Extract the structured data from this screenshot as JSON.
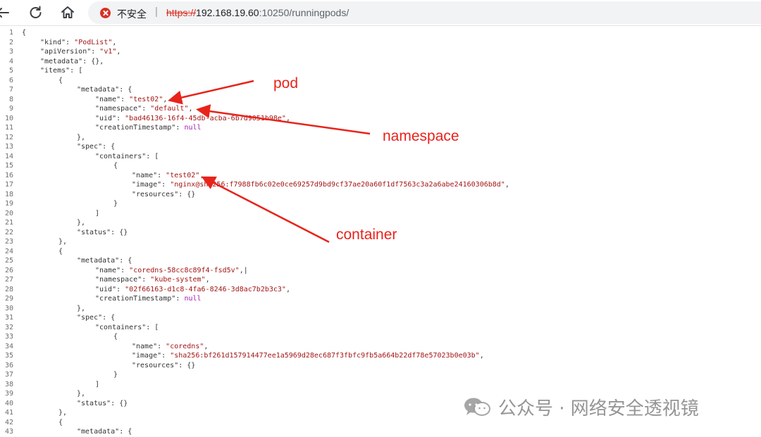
{
  "browser": {
    "security_label": "不安全",
    "url_scheme": "https://",
    "url_host": "192.168.19.60",
    "url_path": ":10250/runningpods/",
    "colors": {
      "warning": "#d93025",
      "scheme_strike": "#d93025"
    }
  },
  "json_view": {
    "lines": [
      {
        "n": "1",
        "indent": 0,
        "t": [
          [
            "p",
            "{"
          ]
        ]
      },
      {
        "n": "2",
        "indent": 1,
        "t": [
          [
            "k",
            "\"kind\""
          ],
          [
            "p",
            ": "
          ],
          [
            "s",
            "\"PodList\""
          ],
          [
            "p",
            ","
          ]
        ]
      },
      {
        "n": "3",
        "indent": 1,
        "t": [
          [
            "k",
            "\"apiVersion\""
          ],
          [
            "p",
            ": "
          ],
          [
            "s",
            "\"v1\""
          ],
          [
            "p",
            ","
          ]
        ]
      },
      {
        "n": "4",
        "indent": 1,
        "t": [
          [
            "k",
            "\"metadata\""
          ],
          [
            "p",
            ": {},"
          ]
        ]
      },
      {
        "n": "5",
        "indent": 1,
        "t": [
          [
            "k",
            "\"items\""
          ],
          [
            "p",
            ": ["
          ]
        ]
      },
      {
        "n": "6",
        "indent": 2,
        "t": [
          [
            "p",
            "{"
          ]
        ]
      },
      {
        "n": "7",
        "indent": 3,
        "t": [
          [
            "k",
            "\"metadata\""
          ],
          [
            "p",
            ": {"
          ]
        ]
      },
      {
        "n": "8",
        "indent": 4,
        "t": [
          [
            "k",
            "\"name\""
          ],
          [
            "p",
            ": "
          ],
          [
            "s",
            "\"test02\""
          ],
          [
            "p",
            ","
          ]
        ]
      },
      {
        "n": "9",
        "indent": 4,
        "t": [
          [
            "k",
            "\"namespace\""
          ],
          [
            "p",
            ": "
          ],
          [
            "s",
            "\"default\""
          ],
          [
            "p",
            ","
          ]
        ]
      },
      {
        "n": "10",
        "indent": 4,
        "t": [
          [
            "k",
            "\"uid\""
          ],
          [
            "p",
            ": "
          ],
          [
            "s",
            "\"bad46136-16f4-45db-acba-6b7d9051b98e\""
          ],
          [
            "p",
            ","
          ]
        ]
      },
      {
        "n": "11",
        "indent": 4,
        "t": [
          [
            "k",
            "\"creationTimestamp\""
          ],
          [
            "p",
            ": "
          ],
          [
            "l",
            "null"
          ]
        ]
      },
      {
        "n": "12",
        "indent": 3,
        "t": [
          [
            "p",
            "},"
          ]
        ]
      },
      {
        "n": "13",
        "indent": 3,
        "t": [
          [
            "k",
            "\"spec\""
          ],
          [
            "p",
            ": {"
          ]
        ]
      },
      {
        "n": "14",
        "indent": 4,
        "t": [
          [
            "k",
            "\"containers\""
          ],
          [
            "p",
            ": ["
          ]
        ]
      },
      {
        "n": "15",
        "indent": 5,
        "t": [
          [
            "p",
            "{"
          ]
        ]
      },
      {
        "n": "16",
        "indent": 6,
        "t": [
          [
            "k",
            "\"name\""
          ],
          [
            "p",
            ": "
          ],
          [
            "s",
            "\"test02\""
          ],
          [
            "p",
            ","
          ]
        ]
      },
      {
        "n": "17",
        "indent": 6,
        "t": [
          [
            "k",
            "\"image\""
          ],
          [
            "p",
            ": "
          ],
          [
            "s",
            "\"nginx@sha256:f7988fb6c02e0ce69257d9bd9cf37ae20a60f1df7563c3a2a6abe24160306b8d\""
          ],
          [
            "p",
            ","
          ]
        ]
      },
      {
        "n": "18",
        "indent": 6,
        "t": [
          [
            "k",
            "\"resources\""
          ],
          [
            "p",
            ": {}"
          ]
        ]
      },
      {
        "n": "19",
        "indent": 5,
        "t": [
          [
            "p",
            "}"
          ]
        ]
      },
      {
        "n": "20",
        "indent": 4,
        "t": [
          [
            "p",
            "]"
          ]
        ]
      },
      {
        "n": "21",
        "indent": 3,
        "t": [
          [
            "p",
            "},"
          ]
        ]
      },
      {
        "n": "22",
        "indent": 3,
        "t": [
          [
            "k",
            "\"status\""
          ],
          [
            "p",
            ": {}"
          ]
        ]
      },
      {
        "n": "23",
        "indent": 2,
        "t": [
          [
            "p",
            "},"
          ]
        ]
      },
      {
        "n": "24",
        "indent": 2,
        "t": [
          [
            "p",
            "{"
          ]
        ]
      },
      {
        "n": "25",
        "indent": 3,
        "t": [
          [
            "k",
            "\"metadata\""
          ],
          [
            "p",
            ": {"
          ]
        ]
      },
      {
        "n": "26",
        "indent": 4,
        "t": [
          [
            "k",
            "\"name\""
          ],
          [
            "p",
            ": "
          ],
          [
            "s",
            "\"coredns-58cc8c89f4-fsd5v\""
          ],
          [
            "p",
            ",|"
          ]
        ]
      },
      {
        "n": "27",
        "indent": 4,
        "t": [
          [
            "k",
            "\"namespace\""
          ],
          [
            "p",
            ": "
          ],
          [
            "s",
            "\"kube-system\""
          ],
          [
            "p",
            ","
          ]
        ]
      },
      {
        "n": "28",
        "indent": 4,
        "t": [
          [
            "k",
            "\"uid\""
          ],
          [
            "p",
            ": "
          ],
          [
            "s",
            "\"02f66163-d1c8-4fa6-8246-3d8ac7b2b3c3\""
          ],
          [
            "p",
            ","
          ]
        ]
      },
      {
        "n": "29",
        "indent": 4,
        "t": [
          [
            "k",
            "\"creationTimestamp\""
          ],
          [
            "p",
            ": "
          ],
          [
            "l",
            "null"
          ]
        ]
      },
      {
        "n": "30",
        "indent": 3,
        "t": [
          [
            "p",
            "},"
          ]
        ]
      },
      {
        "n": "31",
        "indent": 3,
        "t": [
          [
            "k",
            "\"spec\""
          ],
          [
            "p",
            ": {"
          ]
        ]
      },
      {
        "n": "32",
        "indent": 4,
        "t": [
          [
            "k",
            "\"containers\""
          ],
          [
            "p",
            ": ["
          ]
        ]
      },
      {
        "n": "33",
        "indent": 5,
        "t": [
          [
            "p",
            "{"
          ]
        ]
      },
      {
        "n": "34",
        "indent": 6,
        "t": [
          [
            "k",
            "\"name\""
          ],
          [
            "p",
            ": "
          ],
          [
            "s",
            "\"coredns\""
          ],
          [
            "p",
            ","
          ]
        ]
      },
      {
        "n": "35",
        "indent": 6,
        "t": [
          [
            "k",
            "\"image\""
          ],
          [
            "p",
            ": "
          ],
          [
            "s",
            "\"sha256:bf261d157914477ee1a5969d28ec687f3fbfc9fb5a664b22df78e57023b0e03b\""
          ],
          [
            "p",
            ","
          ]
        ]
      },
      {
        "n": "36",
        "indent": 6,
        "t": [
          [
            "k",
            "\"resources\""
          ],
          [
            "p",
            ": {}"
          ]
        ]
      },
      {
        "n": "37",
        "indent": 5,
        "t": [
          [
            "p",
            "}"
          ]
        ]
      },
      {
        "n": "38",
        "indent": 4,
        "t": [
          [
            "p",
            "]"
          ]
        ]
      },
      {
        "n": "39",
        "indent": 3,
        "t": [
          [
            "p",
            "},"
          ]
        ]
      },
      {
        "n": "40",
        "indent": 3,
        "t": [
          [
            "k",
            "\"status\""
          ],
          [
            "p",
            ": {}"
          ]
        ]
      },
      {
        "n": "41",
        "indent": 2,
        "t": [
          [
            "p",
            "},"
          ]
        ]
      },
      {
        "n": "42",
        "indent": 2,
        "t": [
          [
            "p",
            "{"
          ]
        ]
      },
      {
        "n": "43",
        "indent": 3,
        "t": [
          [
            "k",
            "\"metadata\""
          ],
          [
            "p",
            ": {"
          ]
        ]
      }
    ],
    "colors": {
      "key": "#333333",
      "string": "#a31515",
      "literal": "#a020b0",
      "line_number": "#6e6e6e"
    }
  },
  "annotations": {
    "pod_label": "pod",
    "namespace_label": "namespace",
    "container_label": "container",
    "color": "#e8231b"
  },
  "watermark": {
    "text": "公众号 · 网络安全透视镜",
    "icon": "wechat-logo-icon"
  }
}
